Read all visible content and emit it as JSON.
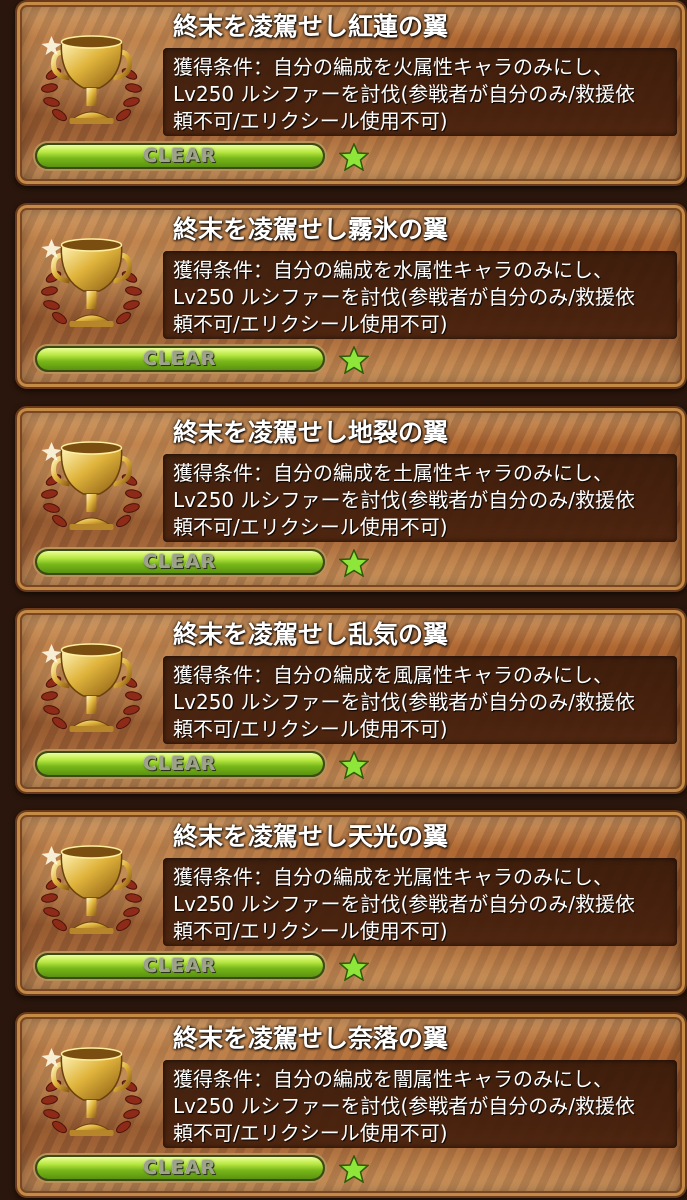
{
  "trophies": [
    {
      "title": "終末を凌駕せし紅蓮の翼",
      "condition": "獲得条件：自分の編成を火属性キャラのみにし、\nLv250 ルシファーを討伐(参戦者が自分のみ/救援依\n頼不可/エリクシール使用不可)",
      "status": "CLEAR",
      "progress": 1.0,
      "icon": "gold-trophy-icon",
      "star_icon": "green-star-icon"
    },
    {
      "title": "終末を凌駕せし霧氷の翼",
      "condition": "獲得条件：自分の編成を水属性キャラのみにし、\nLv250 ルシファーを討伐(参戦者が自分のみ/救援依\n頼不可/エリクシール使用不可)",
      "status": "CLEAR",
      "progress": 1.0,
      "icon": "gold-trophy-icon",
      "star_icon": "green-star-icon"
    },
    {
      "title": "終末を凌駕せし地裂の翼",
      "condition": "獲得条件：自分の編成を土属性キャラのみにし、\nLv250 ルシファーを討伐(参戦者が自分のみ/救援依\n頼不可/エリクシール使用不可)",
      "status": "CLEAR",
      "progress": 1.0,
      "icon": "gold-trophy-icon",
      "star_icon": "green-star-icon"
    },
    {
      "title": "終末を凌駕せし乱気の翼",
      "condition": "獲得条件：自分の編成を風属性キャラのみにし、\nLv250 ルシファーを討伐(参戦者が自分のみ/救援依\n頼不可/エリクシール使用不可)",
      "status": "CLEAR",
      "progress": 1.0,
      "icon": "gold-trophy-icon",
      "star_icon": "green-star-icon"
    },
    {
      "title": "終末を凌駕せし天光の翼",
      "condition": "獲得条件：自分の編成を光属性キャラのみにし、\nLv250 ルシファーを討伐(参戦者が自分のみ/救援依\n頼不可/エリクシール使用不可)",
      "status": "CLEAR",
      "progress": 1.0,
      "icon": "gold-trophy-icon",
      "star_icon": "green-star-icon"
    },
    {
      "title": "終末を凌駕せし奈落の翼",
      "condition": "獲得条件：自分の編成を闇属性キャラのみにし、\nLv250 ルシファーを討伐(参戦者が自分のみ/救援依\n頼不可/エリクシール使用不可)",
      "status": "CLEAR",
      "progress": 1.0,
      "icon": "gold-trophy-icon",
      "star_icon": "green-star-icon"
    }
  ],
  "colors": {
    "title_text": "#ffffff",
    "progress_fill": "#9fd62e",
    "star": "#7ed321",
    "frame_gold": "#c38b45"
  }
}
